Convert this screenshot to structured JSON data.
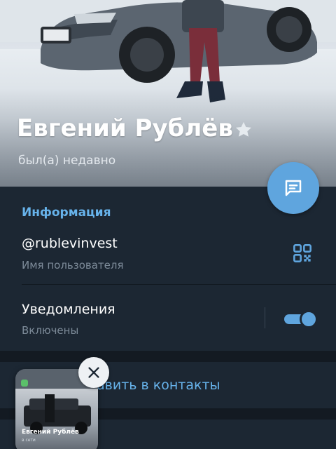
{
  "profile": {
    "name": "Евгений Рублёв",
    "status": "был(а) недавно",
    "verified_icon": "star-icon"
  },
  "fab": {
    "icon": "message-icon"
  },
  "info": {
    "header": "Информация",
    "username": "@rublevinvest",
    "username_label": "Имя пользователя",
    "qr_icon": "qr-code-icon",
    "notifications_title": "Уведомления",
    "notifications_value": "Включены",
    "notifications_enabled": true
  },
  "actions": {
    "add_contact_visible": "авить в контакты"
  },
  "pip": {
    "name": "Евгений Рублёв",
    "status": "в сети",
    "close_icon": "close-icon"
  },
  "colors": {
    "accent": "#67b3eb",
    "fab": "#5fa5de",
    "background": "#1c2733",
    "secondary_text": "#7d8b99"
  }
}
